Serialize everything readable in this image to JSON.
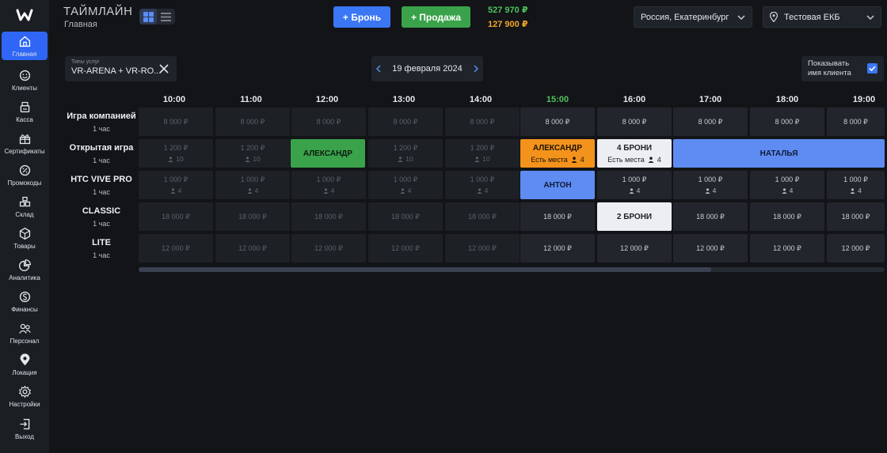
{
  "sidebar": {
    "logo": "W",
    "items": [
      {
        "label": "Главная",
        "icon": "home-icon",
        "active": true
      },
      {
        "label": "Клиенты",
        "icon": "smiley-icon"
      },
      {
        "label": "Касса",
        "icon": "cash-register-icon"
      },
      {
        "label": "Сертификаты",
        "icon": "gift-icon"
      },
      {
        "label": "Промокоды",
        "icon": "percent-icon"
      },
      {
        "label": "Склад",
        "icon": "warehouse-icon"
      },
      {
        "label": "Товары",
        "icon": "box-icon"
      },
      {
        "label": "Аналитика",
        "icon": "pie-chart-icon"
      },
      {
        "label": "Финансы",
        "icon": "finance-icon"
      },
      {
        "label": "Персонал",
        "icon": "staff-icon"
      },
      {
        "label": "Локация",
        "icon": "location-pin-icon"
      },
      {
        "label": "Настройки",
        "icon": "gear-icon"
      },
      {
        "label": "Выход",
        "icon": "logout-icon"
      }
    ]
  },
  "header": {
    "title": "ТАЙМЛАЙН",
    "subtitle": "Главная",
    "booking_button": "+ Бронь",
    "sale_button": "+ Продажа",
    "amount_green": "527 970 ₽",
    "amount_orange": "127 900 ₽",
    "region": "Россия, Екатеринбург",
    "location": "Тестовая ЕКБ"
  },
  "filters": {
    "service_types_label": "Типы услуг",
    "service_types_value": "VR-ARENA + VR-RO...",
    "date": "19 февраля 2024",
    "show_client_name_line1": "Показывать",
    "show_client_name_line2": "имя клиента",
    "show_client_name_checked": true
  },
  "times": [
    "10:00",
    "11:00",
    "12:00",
    "13:00",
    "14:00",
    "15:00",
    "16:00",
    "17:00",
    "18:00",
    "19:00"
  ],
  "current_time_index": 5,
  "rows": [
    {
      "name": "Игра компанией",
      "duration": "1 час",
      "price": "8 000 ₽",
      "seats": ""
    },
    {
      "name": "Открытая игра",
      "duration": "1 час",
      "price": "1 200 ₽",
      "seats": "10"
    },
    {
      "name": "HTC VIVE PRO",
      "duration": "1 час",
      "price": "1 000 ₽",
      "seats": "4"
    },
    {
      "name": "CLASSIC",
      "duration": "1 час",
      "price": "18 000 ₽",
      "seats": ""
    },
    {
      "name": "LITE",
      "duration": "1 час",
      "price": "12 000 ₽",
      "seats": ""
    }
  ],
  "bookings": {
    "b1": {
      "name": "АЛЕКСАНДР"
    },
    "b2": {
      "name": "АЛЕКСАНДР",
      "sub": "Есть места",
      "seats": "4"
    },
    "b3": {
      "name": "4 БРОНИ",
      "sub": "Есть места",
      "seats": "4"
    },
    "b4": {
      "name": "НАТАЛЬЯ"
    },
    "b5": {
      "name": "АНТОН"
    },
    "b6": {
      "name": "2 БРОНИ"
    }
  },
  "colors": {
    "accent_blue": "#3b76f5",
    "green": "#3aa24a",
    "orange": "#f3931c",
    "booking_blue": "#5f8cf3"
  }
}
